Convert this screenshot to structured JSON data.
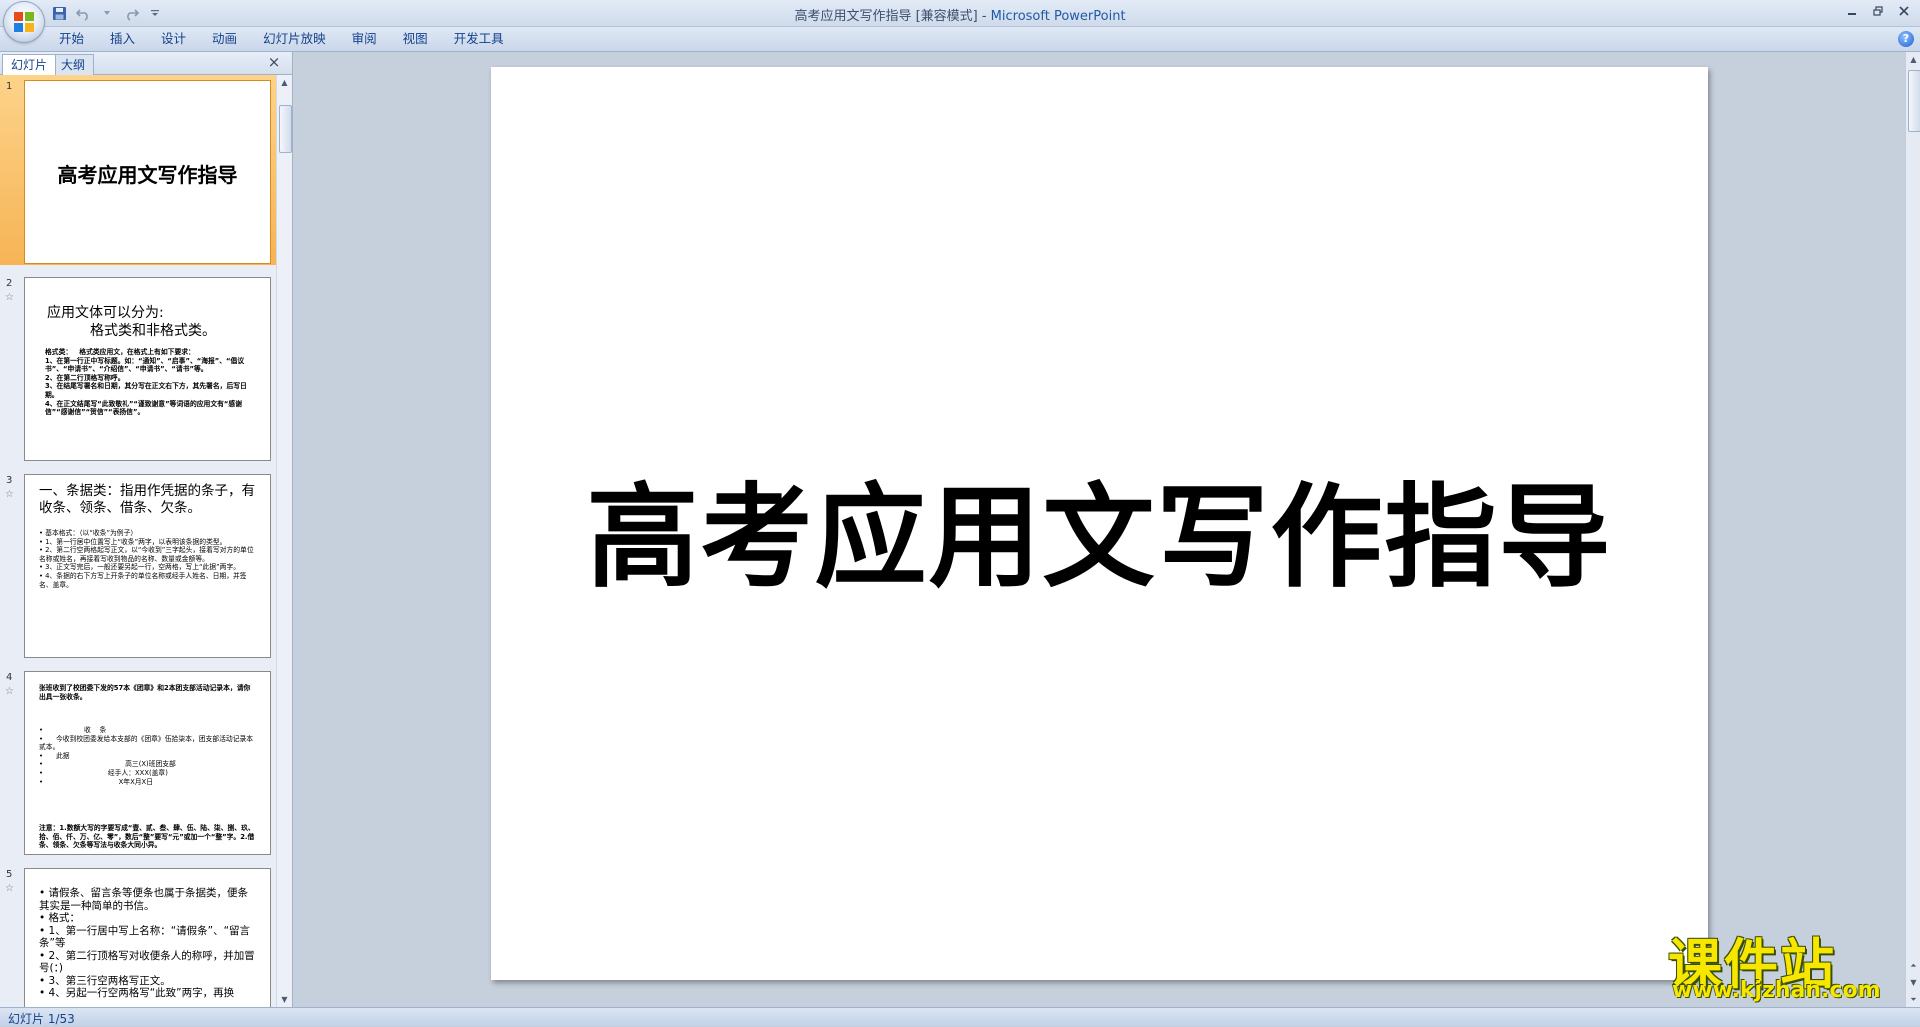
{
  "window": {
    "title_doc": "高考应用文写作指导 [兼容模式] - ",
    "title_app": "Microsoft PowerPoint",
    "controls": [
      "minimize",
      "maximize",
      "close"
    ]
  },
  "qat": {
    "icons": [
      "save-icon",
      "undo-icon",
      "redo-icon",
      "customize-icon"
    ]
  },
  "ribbon": {
    "tabs": [
      "开始",
      "插入",
      "设计",
      "动画",
      "幻灯片放映",
      "审阅",
      "视图",
      "开发工具"
    ],
    "help": "?"
  },
  "left_pane": {
    "tabs": [
      "幻灯片",
      "大纲"
    ],
    "close": "×",
    "thumbs": [
      {
        "num": "1",
        "title": "高考应用文写作指导"
      },
      {
        "num": "2",
        "line1": "应用文体可以分为:",
        "line2": "格式类和非格式类。",
        "body": [
          "格式类：   格式类应用文，在格式上有如下要求：",
          "1、在第一行正中写标题。如：“通知”、“启事”、“海报”、“倡议书”、“申请书”、“介绍信”、“申请书”、“请书”等。",
          "2、在第二行顶格写称呼。",
          "3、在结尾写署名和日期，其分写在正文右下方，其先署名，后写日期。",
          "4、在正文结尾写“此致敬礼”“谨致谢意”等词语的应用文有“感谢信”“感谢信”“贺信”“表扬信”。"
        ]
      },
      {
        "num": "3",
        "title": "一、条据类：指用作凭据的条子，有收条、领条、借条、欠条。",
        "body": [
          "• 基本格式：（以“收条”为例子）",
          "• 1、第一行居中位置写上“收条”两字，以表明该条据的类型。",
          "• 2、第二行空两格起写正文，以“今收到”三字起头，接着写对方的单位名称或姓名，再接着写收到物品的名称、数量或金额等。",
          "• 3、正文写完后，一般还要另起一行，空两格，写上“此据”两字。",
          "• 4、条据的右下方写上开条子的单位名称或经手人姓名、日期，并签名、盖章。"
        ]
      },
      {
        "num": "4",
        "title": "张班收到了校团委下发的57本《团章》和2本团支部活动记录本，请你出具一张收条。",
        "body": [
          "•                   收    条",
          "•      今收到校团委发给本支部的《团章》伍拾柒本，团支部活动记录本贰本。",
          "•      此据",
          "•                                      高三(X)班团支部",
          "•                              经手人：XXX(盖章)",
          "•                                   X年X月X日"
        ],
        "foot": "注意：1.数额大写的字要写成“壹、贰、叁、肆、伍、陆、柒、捌、玖、拾、佰、仟、万、亿、零”，数后“整”要写“元”或加一个“整”字。2.借条、领条、欠条等写法与收条大同小异。"
      },
      {
        "num": "5",
        "body": [
          "• 请假条、留言条等便条也属于条据类，便条其实是一种简单的书信。",
          "• 格式：",
          "• 1、第一行居中写上名称：“请假条”、“留言条”等",
          "• 2、第二行顶格写对收便条人的称呼，并加冒号(：)",
          "• 3、第三行空两格写正文。",
          "• 4、另起一行空两格写“此致”两字，再换"
        ]
      }
    ]
  },
  "slide": {
    "title": "高考应用文写作指导"
  },
  "status": {
    "text": "幻灯片 1/53"
  },
  "watermark": {
    "cn": "课件站",
    "url": "www.kjzhan.com"
  }
}
